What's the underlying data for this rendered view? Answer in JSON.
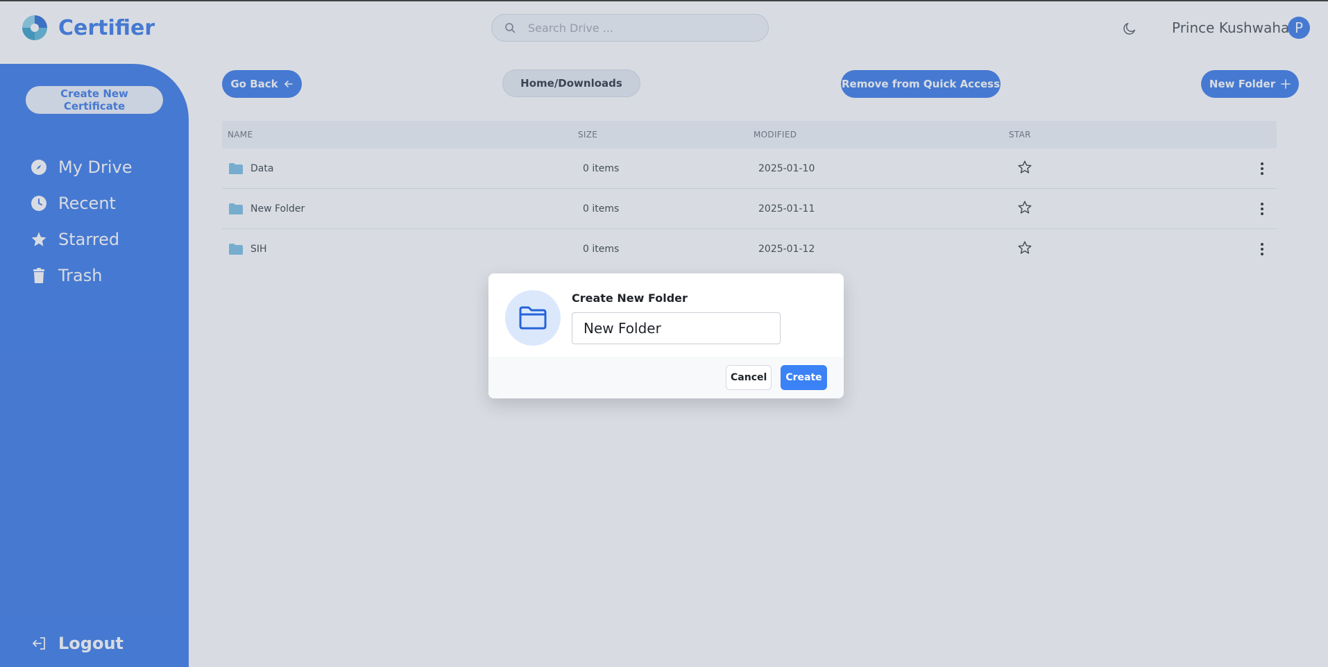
{
  "app": {
    "name": "Certifier"
  },
  "header": {
    "search_placeholder": "Search Drive ...",
    "user_name": "Prince Kushwaha",
    "avatar_initial": "P"
  },
  "sidebar": {
    "create_button": "Create New Certificate",
    "items": [
      {
        "label": "My Drive",
        "icon": "compass-icon"
      },
      {
        "label": "Recent",
        "icon": "clock-icon"
      },
      {
        "label": "Starred",
        "icon": "star-icon"
      },
      {
        "label": "Trash",
        "icon": "trash-icon"
      }
    ],
    "logout_label": "Logout"
  },
  "toolbar": {
    "go_back_label": "Go Back",
    "path": "Home/Downloads",
    "quick_access_label": "Remove from Quick Access",
    "new_folder_label": "New Folder"
  },
  "table": {
    "columns": [
      "NAME",
      "SIZE",
      "MODIFIED",
      "STAR"
    ],
    "rows": [
      {
        "name": "Data",
        "size": "0 items",
        "modified": "2025-01-10"
      },
      {
        "name": "New Folder",
        "size": "0 items",
        "modified": "2025-01-11"
      },
      {
        "name": "SIH",
        "size": "0 items",
        "modified": "2025-01-12"
      }
    ]
  },
  "modal": {
    "title": "Create New Folder",
    "input_value": "New Folder",
    "cancel_label": "Cancel",
    "create_label": "Create"
  },
  "colors": {
    "brand": "#3d7be8",
    "primary_button": "#3b82f6",
    "folder": "#7cc0e6"
  }
}
